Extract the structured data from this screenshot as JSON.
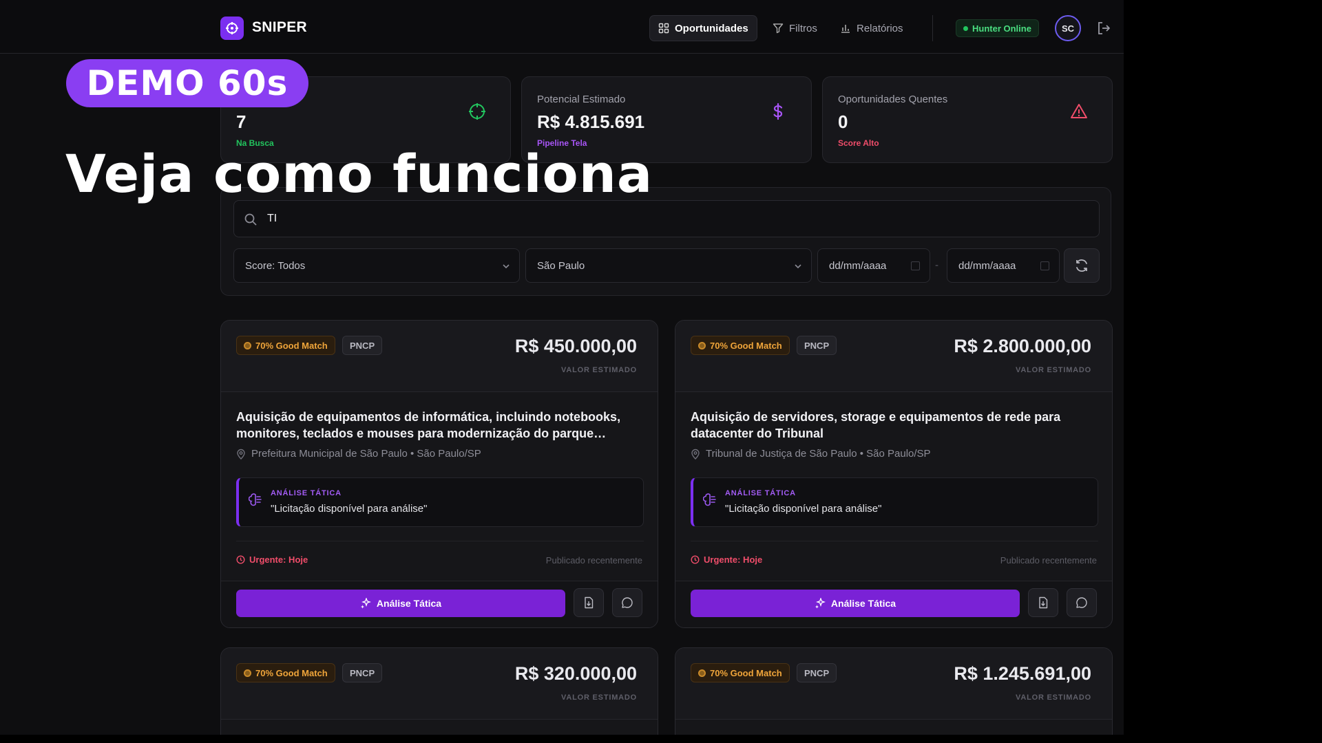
{
  "brand": "SNIPER",
  "nav": [
    {
      "label": "Oportunidades",
      "active": true
    },
    {
      "label": "Filtros",
      "active": false
    },
    {
      "label": "Relatórios",
      "active": false
    }
  ],
  "status": "Hunter Online",
  "user_initials": "SC",
  "stats": [
    {
      "label": "",
      "value": "7",
      "sub": "Na Busca",
      "sub_color": "#22c55e",
      "icon": "crosshair-icon"
    },
    {
      "label": "Potencial Estimado",
      "value": "R$ 4.815.691",
      "sub": "Pipeline Tela",
      "sub_color": "#a855f7",
      "icon": "dollar-icon"
    },
    {
      "label": "Oportunidades Quentes",
      "value": "0",
      "sub": "Score Alto",
      "sub_color": "#f04d6a",
      "icon": "alert-triangle-icon"
    }
  ],
  "search": {
    "value": "TI"
  },
  "filters": {
    "score": "Score: Todos",
    "state": "São Paulo",
    "date_from": "dd/mm/aaaa",
    "date_to": "dd/mm/aaaa",
    "date_sep": "-"
  },
  "cards": [
    {
      "match": "70% Good Match",
      "source": "PNCP",
      "value": "R$ 450.000,00",
      "value_label": "VALOR ESTIMADO",
      "title": "Aquisição de equipamentos de informática, incluindo notebooks, monitores, teclados e mouses para modernização do parque tecnológico",
      "location": "Prefeitura Municipal de São Paulo • São Paulo/SP",
      "analysis_header": "ANÁLISE TÁTICA",
      "analysis_text": "\"Licitação disponível para análise\"",
      "urgency": "Urgente: Hoje",
      "published": "Publicado recentemente",
      "action": "Análise Tática"
    },
    {
      "match": "70% Good Match",
      "source": "PNCP",
      "value": "R$ 2.800.000,00",
      "value_label": "VALOR ESTIMADO",
      "title": "Aquisição de servidores, storage e equipamentos de rede para datacenter do Tribunal",
      "location": "Tribunal de Justiça de São Paulo • São Paulo/SP",
      "analysis_header": "ANÁLISE TÁTICA",
      "analysis_text": "\"Licitação disponível para análise\"",
      "urgency": "Urgente: Hoje",
      "published": "Publicado recentemente",
      "action": "Análise Tática"
    },
    {
      "match": "70% Good Match",
      "source": "PNCP",
      "value": "R$ 320.000,00",
      "value_label": "VALOR ESTIMADO"
    },
    {
      "match": "70% Good Match",
      "source": "PNCP",
      "value": "R$ 1.245.691,00",
      "value_label": "VALOR ESTIMADO"
    }
  ],
  "overlay": {
    "badge": "DEMO 60s",
    "headline": "Veja como funciona"
  }
}
